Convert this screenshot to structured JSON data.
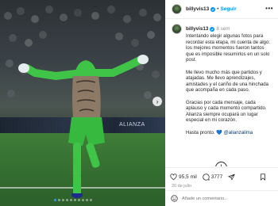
{
  "post": {
    "username": "billyvis13",
    "header_separator": "•",
    "follow_label": "Seguir",
    "more_label": "•••",
    "time_ago": "8 sem",
    "caption": [
      "Intentando elegir algunas fotos para recordar esta etapa, mi cuenta de algo: los mejores momentos fueron tantos que es imposible resumirlos en un solo post.",
      "Me llevo mucho más que partidos y atajadas. Me llevo aprendizajes, amistades y el cariño de una hinchada que acompaña en cada paso.",
      "Gracias por cada mensaje, cada aplauso y cada momento compartido. Alianza siempre ocupará un lugar especial en mi corazón."
    ],
    "signoff": "Hasta pronto.",
    "signoff_heart": "💙",
    "mention": "@alianzalima",
    "load_more_label": "+",
    "next_comment_preview": "...",
    "likes": "95,5 mil",
    "comments": "3777",
    "date": "20 de julio",
    "comment_placeholder": "Añade un comentario..."
  },
  "media": {
    "next_label": "›",
    "ad_board_text": "ALIANZA",
    "dots_count": 10,
    "active_dot": 0
  },
  "colors": {
    "link": "#0095f6",
    "mention": "#00376b",
    "muted": "#8e8e8e",
    "jersey": "#3fc447"
  },
  "icons": [
    "verified-icon",
    "heart-icon",
    "comment-icon",
    "share-icon",
    "bookmark-icon",
    "emoji-icon",
    "chevron-right-icon",
    "plus-circle-icon"
  ]
}
